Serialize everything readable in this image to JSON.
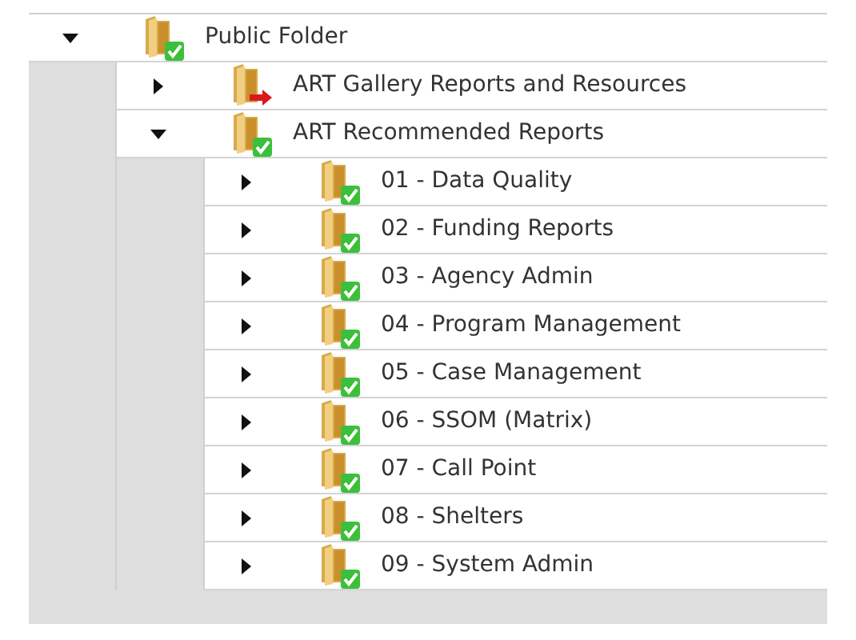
{
  "tree": [
    {
      "label": "Public Folder",
      "kind": "shared",
      "expanded": true,
      "children": [
        {
          "label": "ART Gallery Reports and Resources",
          "kind": "link",
          "expanded": false
        },
        {
          "label": "ART Recommended Reports",
          "kind": "shared",
          "expanded": true,
          "children": [
            {
              "label": "01 - Data Quality",
              "kind": "shared",
              "expanded": false
            },
            {
              "label": "02 - Funding Reports",
              "kind": "shared",
              "expanded": false
            },
            {
              "label": "03 - Agency Admin",
              "kind": "shared",
              "expanded": false
            },
            {
              "label": "04 - Program Management",
              "kind": "shared",
              "expanded": false
            },
            {
              "label": "05 - Case Management",
              "kind": "shared",
              "expanded": false
            },
            {
              "label": "06 - SSOM (Matrix)",
              "kind": "shared",
              "expanded": false
            },
            {
              "label": "07 - Call Point",
              "kind": "shared",
              "expanded": false
            },
            {
              "label": "08 - Shelters",
              "kind": "shared",
              "expanded": false
            },
            {
              "label": "09 - System Admin",
              "kind": "shared",
              "expanded": false
            }
          ]
        }
      ]
    }
  ]
}
